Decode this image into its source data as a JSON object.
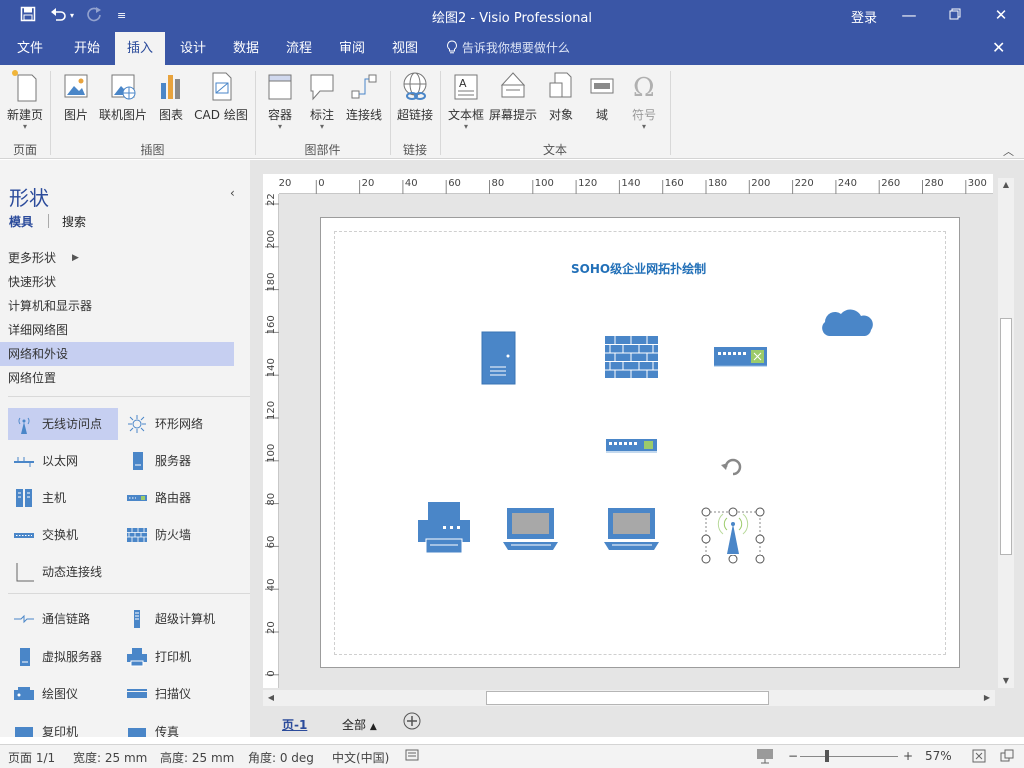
{
  "window": {
    "title": "绘图2 - Visio Professional",
    "login": "登录"
  },
  "menu": {
    "tabs": [
      "文件",
      "开始",
      "插入",
      "设计",
      "数据",
      "流程",
      "审阅",
      "视图"
    ],
    "active": "插入",
    "tell_me": "告诉我你想要做什么"
  },
  "ribbon": {
    "buttons": {
      "new_page": "新建页",
      "picture": "图片",
      "online_picture": "联机图片",
      "chart": "图表",
      "cad": "CAD 绘图",
      "container": "容器",
      "callout": "标注",
      "connector": "连接线",
      "hyperlink": "超链接",
      "textbox": "文本框",
      "screentip": "屏幕提示",
      "object": "对象",
      "field": "域",
      "symbol": "符号"
    },
    "groups": {
      "page": "页面",
      "illustrations": "插图",
      "diagram_parts": "图部件",
      "links": "链接",
      "text": "文本"
    }
  },
  "shapes_pane": {
    "title": "形状",
    "tabs": {
      "stencils": "模具",
      "search": "搜索"
    },
    "stencils": [
      "更多形状",
      "快速形状",
      "计算机和显示器",
      "详细网络图",
      "网络和外设",
      "网络位置"
    ],
    "selected_stencil": "网络和外设",
    "items": {
      "wap": "无线访问点",
      "ring": "环形网络",
      "ethernet": "以太网",
      "server": "服务器",
      "mainframe": "主机",
      "router": "路由器",
      "switch": "交换机",
      "firewall": "防火墙",
      "dynamic_connector": "动态连接线",
      "comm_link": "通信链路",
      "supercomputer": "超级计算机",
      "virtual_server": "虚拟服务器",
      "printer": "打印机",
      "plotter": "绘图仪",
      "scanner": "扫描仪",
      "copier": "复印机",
      "fax": "传真"
    }
  },
  "ruler": {
    "h_ticks": [
      "-20",
      "0",
      "20",
      "40",
      "60",
      "80",
      "100",
      "120",
      "140",
      "160",
      "180",
      "200",
      "220",
      "240",
      "260",
      "280",
      "300"
    ],
    "v_ticks": [
      "220",
      "200",
      "180",
      "160",
      "140",
      "120",
      "100",
      "80",
      "60",
      "40",
      "20",
      "0"
    ]
  },
  "diagram": {
    "title": "SOHO级企业网拓扑绘制"
  },
  "page_tabs": {
    "page1": "页-1",
    "all": "全部"
  },
  "status": {
    "page": "页面 1/1",
    "width": "宽度: 25 mm",
    "height": "高度: 25 mm",
    "angle": "角度: 0 deg",
    "language": "中文(中国)",
    "zoom": "57%"
  },
  "colors": {
    "brand": "#3a56a6",
    "shape_blue": "#4a86c8",
    "title_text": "#2270b8"
  }
}
